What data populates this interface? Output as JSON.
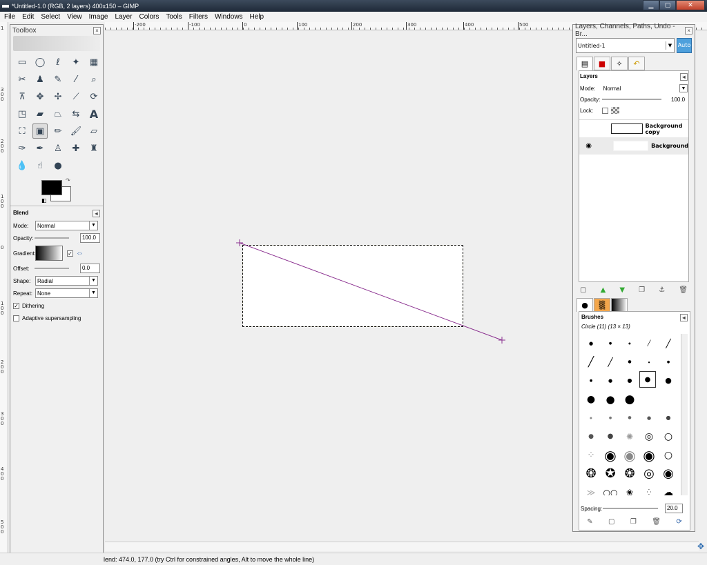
{
  "window": {
    "title": "*Untitled-1.0 (RGB, 2 layers) 400x150 – GIMP"
  },
  "menu": [
    "File",
    "Edit",
    "Select",
    "View",
    "Image",
    "Layer",
    "Colors",
    "Tools",
    "Filters",
    "Windows",
    "Help"
  ],
  "ruler": {
    "h_labels": [
      "-200",
      "-100",
      "0",
      "100",
      "200",
      "300",
      "400",
      "500"
    ],
    "v_labels": [
      "1",
      "300",
      "200",
      "100",
      "0",
      "100",
      "200",
      "300",
      "400",
      "500"
    ]
  },
  "toolbox": {
    "title": "Toolbox",
    "options": {
      "heading": "Blend",
      "mode_label": "Mode:",
      "mode_value": "Normal",
      "opacity_label": "Opacity:",
      "opacity_value": "100.0",
      "gradient_label": "Gradient:",
      "offset_label": "Offset:",
      "offset_value": "0.0",
      "shape_label": "Shape:",
      "shape_value": "Radial",
      "repeat_label": "Repeat:",
      "repeat_value": "None",
      "dithering_label": "Dithering",
      "dithering_checked": true,
      "adaptive_label": "Adaptive supersampling",
      "adaptive_checked": false
    }
  },
  "dock": {
    "title": "Layers, Channels, Paths, Undo - Br...",
    "image_select": "Untitled-1",
    "auto_label": "Auto",
    "layers": {
      "heading": "Layers",
      "mode_label": "Mode:",
      "mode_value": "Normal",
      "opacity_label": "Opacity:",
      "opacity_value": "100.0",
      "lock_label": "Lock:",
      "items": [
        {
          "name": "Background copy",
          "visible": false
        },
        {
          "name": "Background",
          "visible": true
        }
      ]
    },
    "brushes": {
      "heading": "Brushes",
      "subtitle": "Circle (11) (13 × 13)",
      "spacing_label": "Spacing:",
      "spacing_value": "20.0"
    }
  },
  "status": {
    "text": "lend: 474.0, 177.0 (try Ctrl for constrained angles, Alt to move the whole line)"
  }
}
